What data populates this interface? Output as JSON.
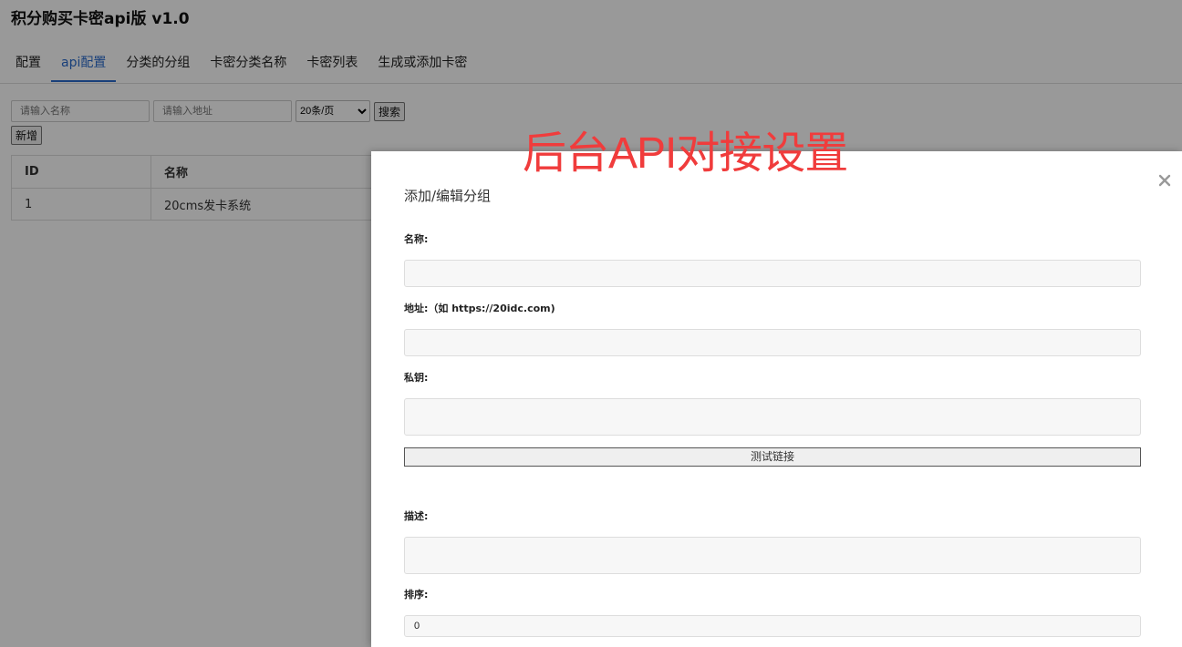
{
  "app": {
    "title": "积分购买卡密api版 v1.0"
  },
  "nav": {
    "tabs": [
      {
        "label": "配置"
      },
      {
        "label": "api配置",
        "active": true
      },
      {
        "label": "分类的分组"
      },
      {
        "label": "卡密分类名称"
      },
      {
        "label": "卡密列表"
      },
      {
        "label": "生成或添加卡密"
      }
    ]
  },
  "toolbar": {
    "name_placeholder": "请输入名称",
    "address_placeholder": "请输入地址",
    "page_size": "20条/页",
    "search_label": "搜索",
    "add_label": "新增"
  },
  "table": {
    "headers": [
      "ID",
      "名称"
    ],
    "rows": [
      {
        "id": "1",
        "name": "20cms发卡系统"
      }
    ]
  },
  "caption": "后台API对接设置",
  "modal": {
    "title": "添加/编辑分组",
    "close_icon": "close-icon",
    "fields": {
      "name_label": "名称:",
      "name_value": "",
      "address_label": "地址:（如 https://20idc.com)",
      "address_value": "",
      "key_label": "私钥:",
      "key_value": "",
      "test_label": "测试链接",
      "desc_label": "描述:",
      "desc_value": "",
      "sort_label": "排序:",
      "sort_value": "0"
    }
  },
  "colors": {
    "accent": "#2a6bcc",
    "caption": "#f03c3c"
  }
}
